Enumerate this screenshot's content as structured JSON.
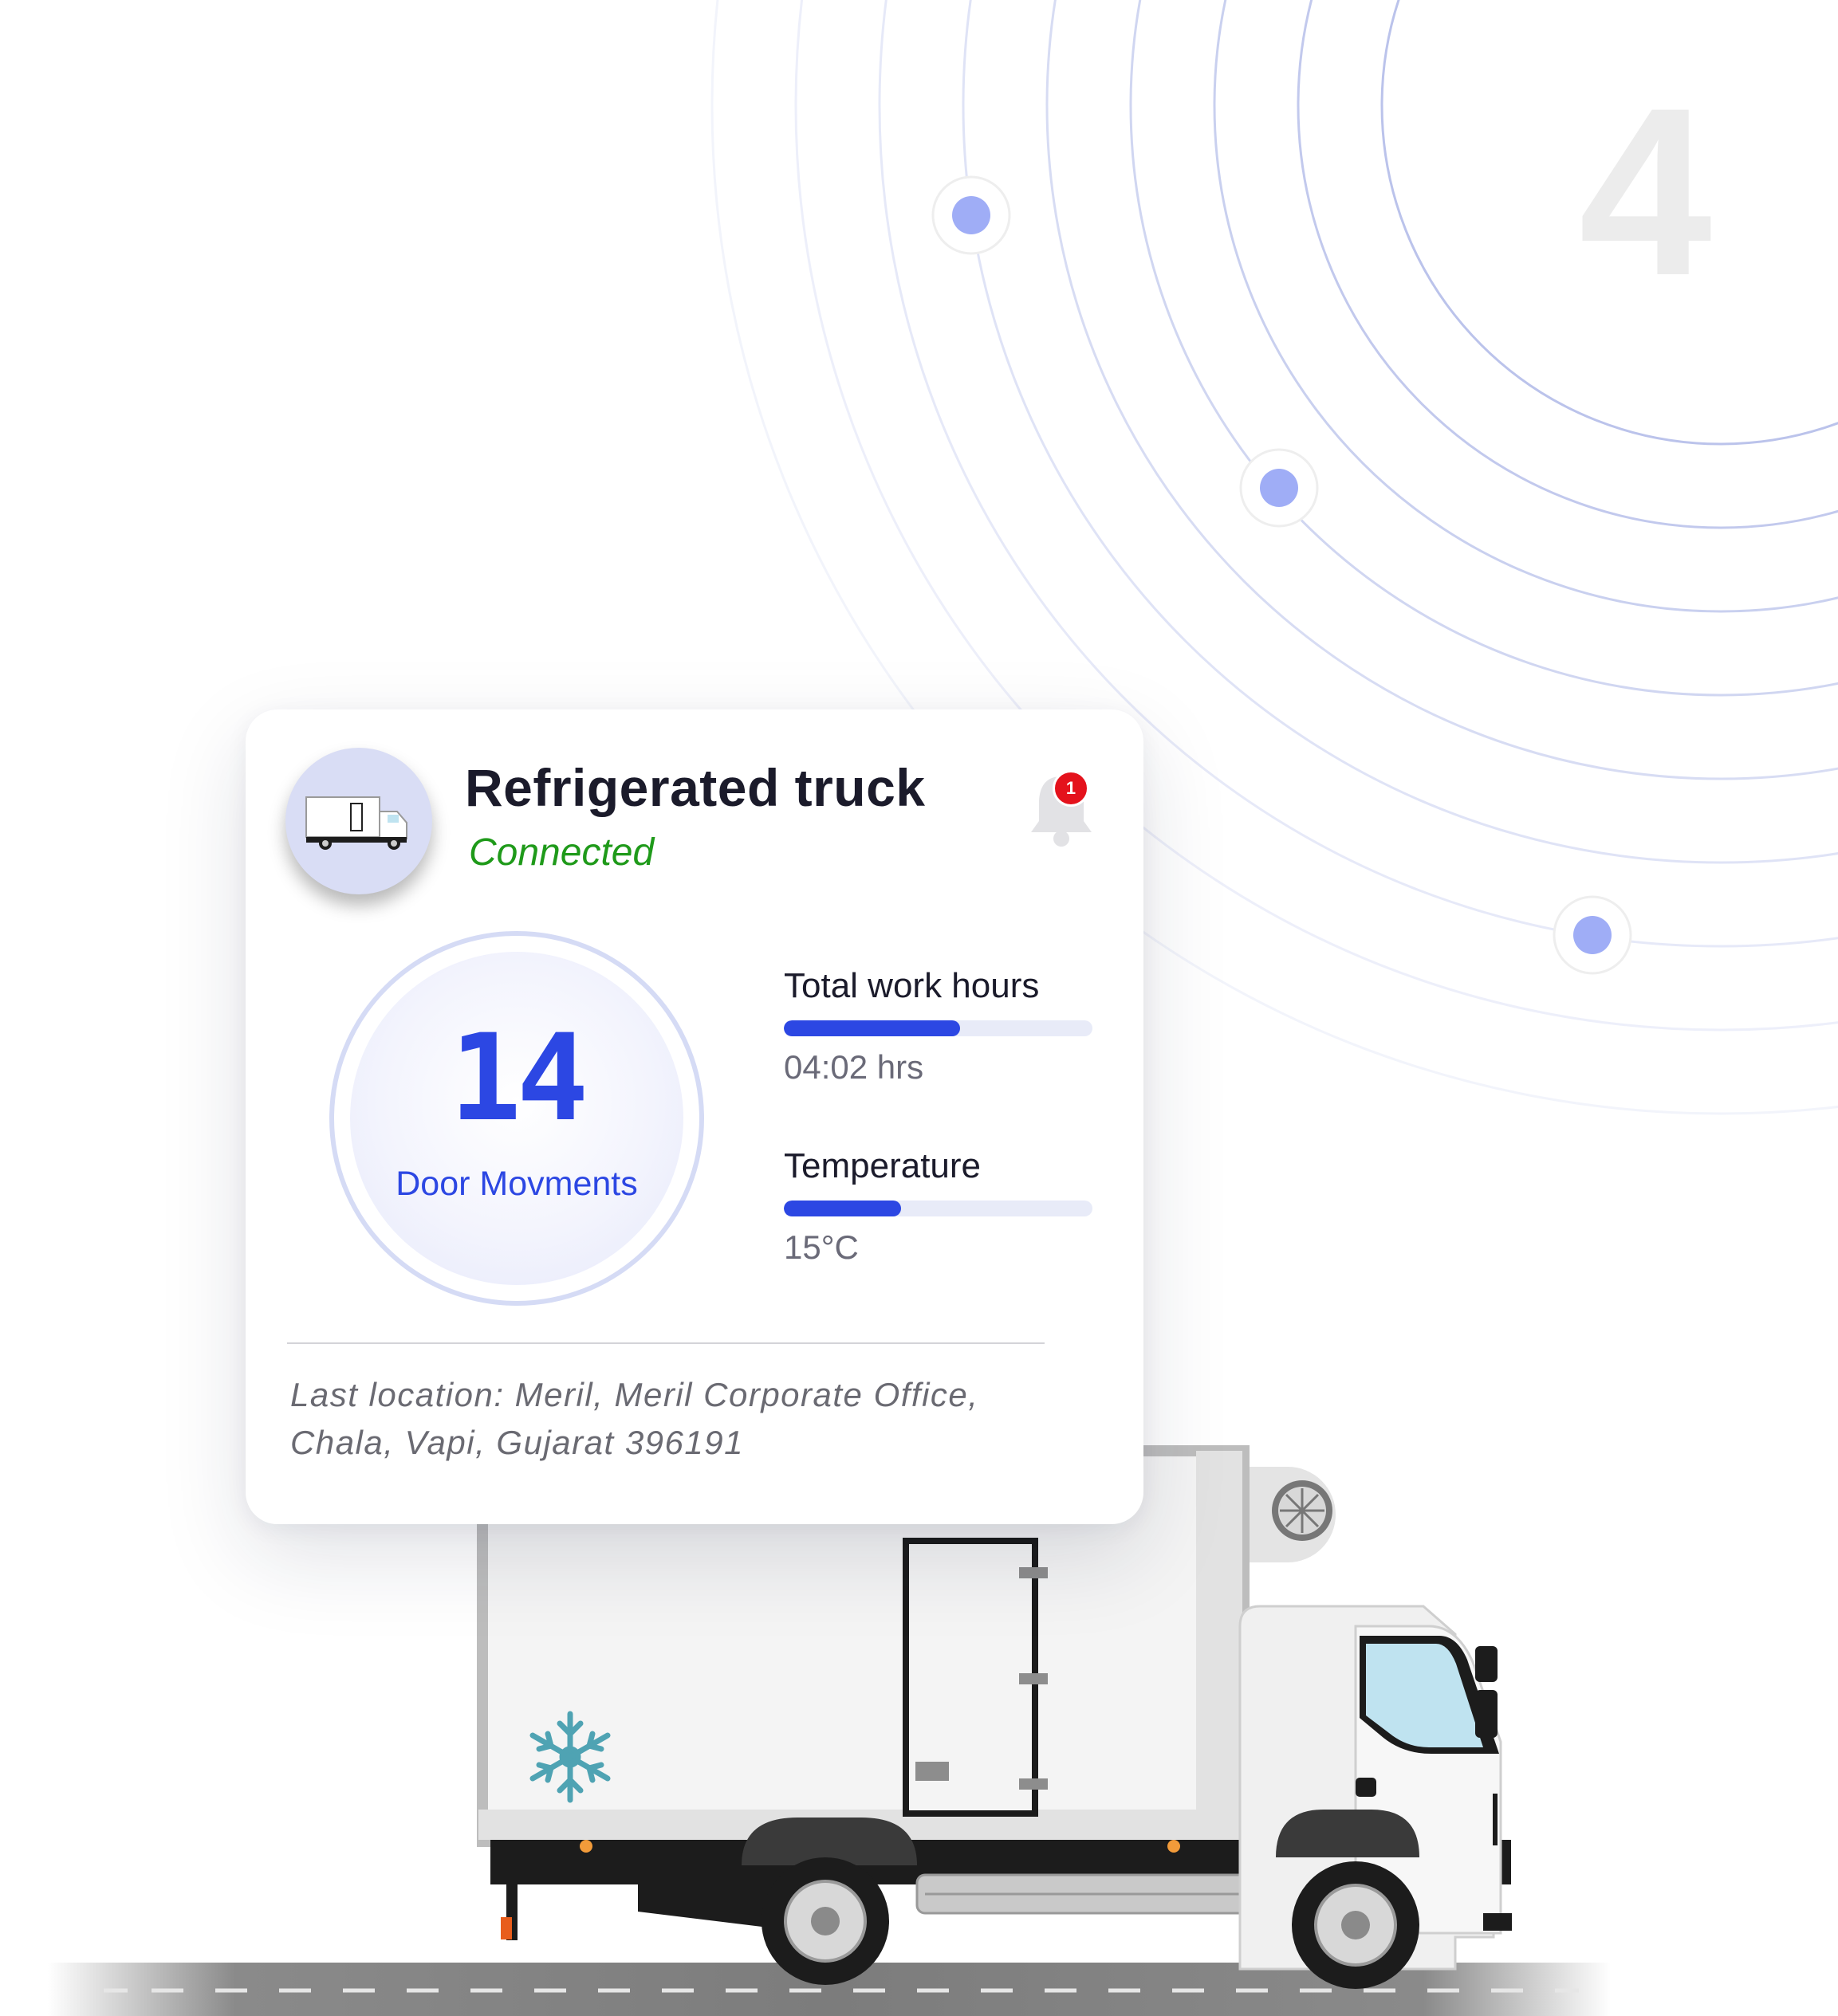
{
  "step_number": "4",
  "device": {
    "title": "Refrigerated truck",
    "status": "Connected",
    "notification_count": "1"
  },
  "door_movements": {
    "value": "14",
    "label": "Door Movments"
  },
  "metrics": [
    {
      "label": "Total work hours",
      "value": "04:02 hrs",
      "level": 0.57
    },
    {
      "label": "Temperature",
      "value": "15°C",
      "level": 0.38
    }
  ],
  "location": {
    "line1": "Last location: Meril, Meril Corporate Office,",
    "line2": "Chala, Vapi, Gujarat 396191"
  },
  "colors": {
    "accent": "#2c47e3",
    "connected": "#1f9a1a",
    "badge": "#e4121c",
    "signal_dot": "#9fadf6"
  },
  "icons": {
    "notification": "bell-icon",
    "avatar": "truck-icon",
    "decoration": "snowflake-icon"
  }
}
